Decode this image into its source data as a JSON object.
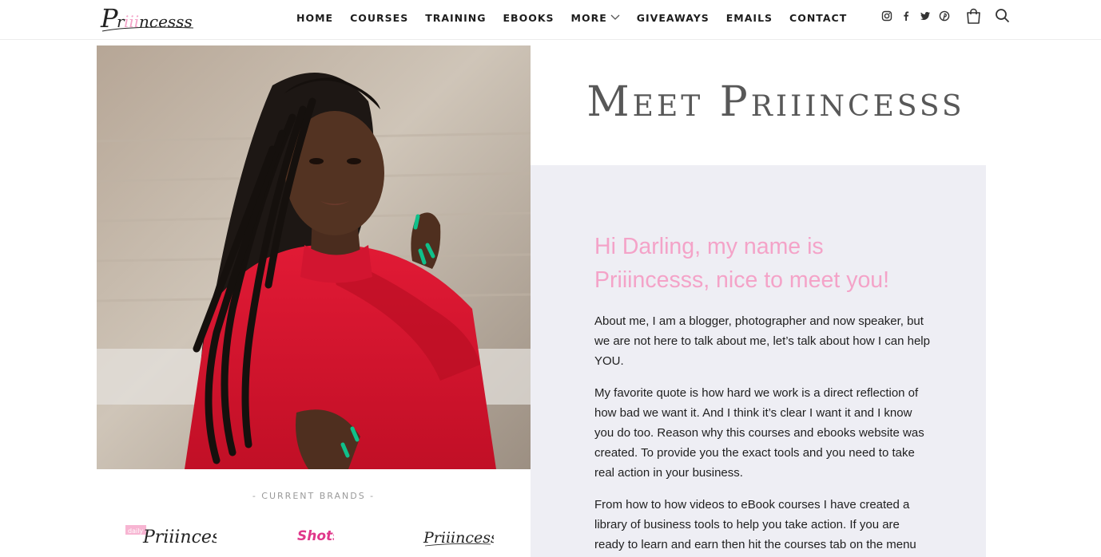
{
  "header": {
    "logo_text": "Priiincesss",
    "nav": [
      "HOME",
      "COURSES",
      "TRAINING",
      "EBOOKS",
      "MORE",
      "GIVEAWAYS",
      "EMAILS",
      "CONTACT"
    ],
    "social_icons": [
      "instagram-icon",
      "facebook-icon",
      "twitter-icon",
      "pinterest-icon"
    ],
    "cart_icon": "shopping-bag-icon",
    "search_icon": "search-icon"
  },
  "hero": {
    "title": "Meet Priiincesss"
  },
  "about": {
    "greeting": "Hi Darling, my name is Priiincesss, nice to meet you!",
    "paragraphs": [
      "About me, I am a blogger, photographer and now speaker, but we are not here to talk about me, let’s talk about how I can help YOU.",
      "My favorite quote is how hard we work is a direct reflection of how  bad we want it. And I think it’s clear I want it and I know you do too. Reason why this courses and ebooks website was created. To provide you the exact tools and you need to take real action in your business.",
      "From how to how videos to eBook courses I have created a library of business tools to help you take action. If you are ready to learn and earn then hit the courses tab on the menu"
    ]
  },
  "brands": {
    "title": "- CURRENT BRANDS -",
    "logos": [
      {
        "name": "Priiincesss",
        "tag": "daily"
      },
      {
        "name": "Shots"
      },
      {
        "name": "Priiincesss"
      }
    ]
  },
  "colors": {
    "accent_pink": "#f4a3c8",
    "panel_bg": "#eeeef4",
    "title_gray": "#585858"
  }
}
